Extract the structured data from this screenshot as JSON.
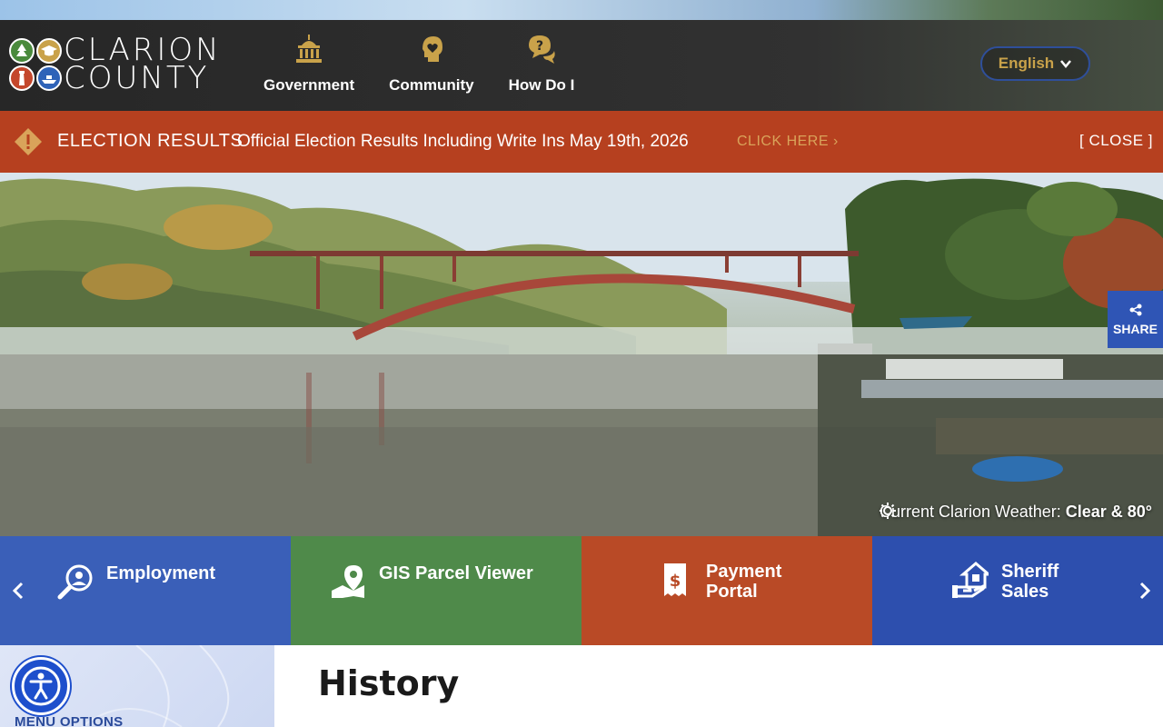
{
  "logo": {
    "line1": "CLARION",
    "line2": "COUNTY"
  },
  "nav": {
    "items": [
      {
        "label": "Government",
        "icon": "capitol-building-icon"
      },
      {
        "label": "Community",
        "icon": "head-heart-icon"
      },
      {
        "label": "How Do I",
        "icon": "question-bubbles-icon"
      }
    ]
  },
  "language": {
    "label": "English"
  },
  "alert": {
    "title": "ELECTION RESULTS",
    "text": "Official Election Results Including Write Ins May 19th, 2026",
    "link": "CLICK HERE ›",
    "close": "[ CLOSE ]"
  },
  "hero": {
    "weather_prefix": "Current Clarion Weather: ",
    "weather_value": "Clear & 80°",
    "share_label": "SHARE"
  },
  "quick_links": [
    {
      "label": "Employment",
      "icon": "person-search-icon",
      "color": "#3a5fb8"
    },
    {
      "label": "GIS Parcel Viewer",
      "icon": "map-pin-icon",
      "color": "#4f8a4a"
    },
    {
      "label": "Payment Portal",
      "icon": "dollar-receipt-icon",
      "color": "#b94a26"
    },
    {
      "label": "Sheriff Sales",
      "icon": "house-hand-icon",
      "color": "#2d4fae"
    }
  ],
  "sidebar": {
    "menu_label": "MENU OPTIONS"
  },
  "page": {
    "title": "History"
  },
  "colors": {
    "header_bg": "#262626",
    "accent_gold": "#c9a24a",
    "alert_bg": "#b6401f",
    "link_blue": "#2f55b5"
  }
}
